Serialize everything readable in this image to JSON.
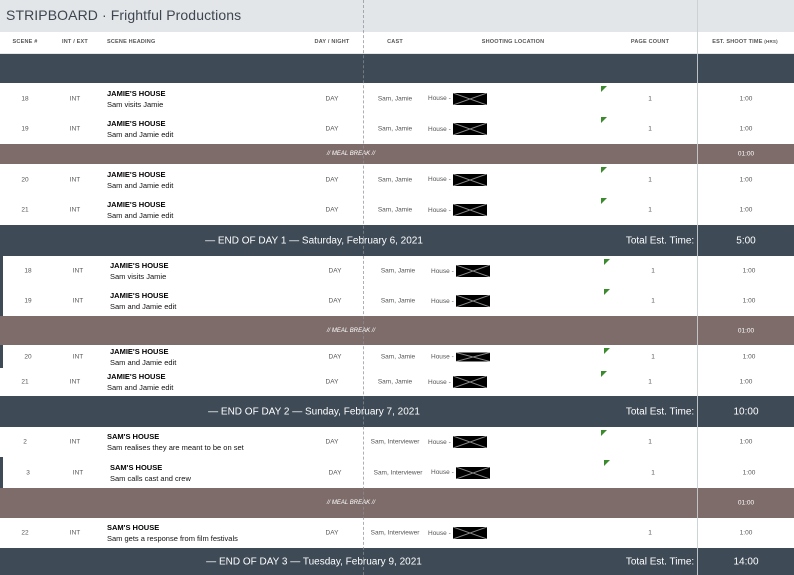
{
  "app": {
    "title": "STRIPBOARD · Frightful Productions"
  },
  "columns": {
    "scene": "SCENE #",
    "intext": "INT / EXT",
    "heading": "SCENE HEADING",
    "daynight": "DAY / NIGHT",
    "cast": "CAST",
    "location": "SHOOTING LOCATION",
    "pages": "PAGE COUNT",
    "est": "EST. SHOOT TIME",
    "est_unit": "(HRS)"
  },
  "rows": [
    {
      "scene": "18",
      "intext": "INT",
      "heading": "JAMIE'S HOUSE",
      "desc": "Sam visits Jamie",
      "daynight": "DAY",
      "cast": "Sam, Jamie",
      "location": "House -",
      "pages": "1",
      "time": "1:00"
    },
    {
      "scene": "19",
      "intext": "INT",
      "heading": "JAMIE'S HOUSE",
      "desc": "Sam and Jamie edit",
      "daynight": "DAY",
      "cast": "Sam, Jamie",
      "location": "House -",
      "pages": "1",
      "time": "1:00"
    },
    {
      "scene": "20",
      "intext": "INT",
      "heading": "JAMIE'S HOUSE",
      "desc": "Sam and Jamie edit",
      "daynight": "DAY",
      "cast": "Sam, Jamie",
      "location": "House -",
      "pages": "1",
      "time": "1:00"
    },
    {
      "scene": "21",
      "intext": "INT",
      "heading": "JAMIE'S HOUSE",
      "desc": "Sam and Jamie edit",
      "daynight": "DAY",
      "cast": "Sam, Jamie",
      "location": "House -",
      "pages": "1",
      "time": "1:00"
    },
    {
      "scene": "18",
      "intext": "INT",
      "heading": "JAMIE'S HOUSE",
      "desc": "Sam visits Jamie",
      "daynight": "DAY",
      "cast": "Sam, Jamie",
      "location": "House -",
      "pages": "1",
      "time": "1:00"
    },
    {
      "scene": "19",
      "intext": "INT",
      "heading": "JAMIE'S HOUSE",
      "desc": "Sam and Jamie edit",
      "daynight": "DAY",
      "cast": "Sam, Jamie",
      "location": "House -",
      "pages": "1",
      "time": "1:00"
    },
    {
      "scene": "20",
      "intext": "INT",
      "heading": "JAMIE'S HOUSE",
      "desc": "Sam and Jamie edit",
      "daynight": "DAY",
      "cast": "Sam, Jamie",
      "location": "House -",
      "pages": "1",
      "time": "1:00"
    },
    {
      "scene": "21",
      "intext": "INT",
      "heading": "JAMIE'S HOUSE",
      "desc": "Sam and Jamie edit",
      "daynight": "DAY",
      "cast": "Sam, Jamie",
      "location": "House -",
      "pages": "1",
      "time": "1:00"
    },
    {
      "scene": "2",
      "intext": "INT",
      "heading": "SAM'S HOUSE",
      "desc": "Sam realises they are meant to be on set",
      "daynight": "DAY",
      "cast": "Sam, Interviewer",
      "location": "House -",
      "pages": "1",
      "time": "1:00"
    },
    {
      "scene": "3",
      "intext": "INT",
      "heading": "SAM'S HOUSE",
      "desc": "Sam calls cast and crew",
      "daynight": "DAY",
      "cast": "Sam, Interviewer",
      "location": "House -",
      "pages": "1",
      "time": "1:00"
    },
    {
      "scene": "22",
      "intext": "INT",
      "heading": "SAM'S HOUSE",
      "desc": "Sam gets a response from film festivals",
      "daynight": "DAY",
      "cast": "Sam, Interviewer",
      "location": "House -",
      "pages": "1",
      "time": "1:00"
    }
  ],
  "meal_breaks": [
    {
      "label": "// MEAL BREAK //",
      "time": "01:00"
    },
    {
      "label": "// MEAL BREAK //",
      "time": "01:00"
    },
    {
      "label": "// MEAL BREAK //",
      "time": "01:00"
    }
  ],
  "day_ends": [
    {
      "label": "— END OF DAY 1 — Saturday, February 6, 2021",
      "total_label": "Total Est. Time:",
      "total": "5:00"
    },
    {
      "label": "— END OF DAY 2 — Sunday, February 7, 2021",
      "total_label": "Total Est. Time:",
      "total": "10:00"
    },
    {
      "label": "— END OF DAY 3 — Tuesday, February 9, 2021",
      "total_label": "Total Est. Time:",
      "total": "14:00"
    }
  ],
  "colors": {
    "header_bg": "#e3e6e9",
    "day_band": "#3e4a56",
    "meal_band": "#7e6c6a",
    "flag": "#3c8a2e"
  }
}
